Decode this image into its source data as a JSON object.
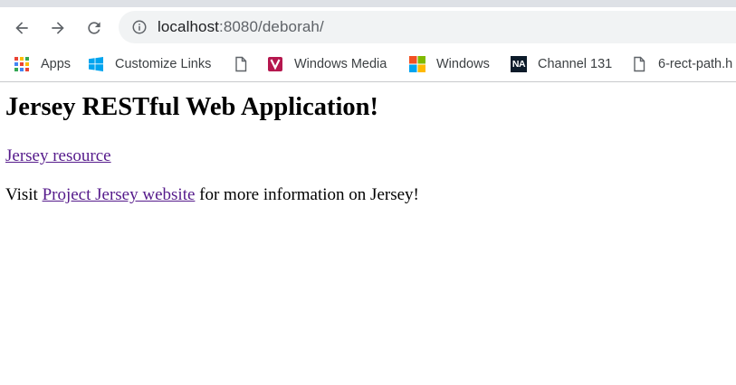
{
  "browser": {
    "address_bar": {
      "host": "localhost",
      "path": ":8080/deborah/"
    },
    "bookmarks": [
      {
        "label": "Apps",
        "icon": "apps-grid-icon"
      },
      {
        "label": "Customize Links",
        "icon": "windows-logo-icon"
      },
      {
        "label": "",
        "icon": "page-icon"
      },
      {
        "label": "Windows Media",
        "icon": "windows-media-icon"
      },
      {
        "label": "Windows",
        "icon": "microsoft-logo-icon"
      },
      {
        "label": "Channel 131",
        "icon": "channel-na-icon"
      },
      {
        "label": "6-rect-path.h",
        "icon": "page-icon"
      }
    ]
  },
  "page": {
    "heading": "Jersey RESTful Web Application!",
    "resource_link": "Jersey resource",
    "visit_prefix": "Visit ",
    "project_link": "Project Jersey website",
    "visit_suffix": " for more information on Jersey!"
  },
  "colors": {
    "link_visited": "#551a8b",
    "omnibox_bg": "#f1f3f4",
    "tab_strip": "#dee1e6"
  }
}
